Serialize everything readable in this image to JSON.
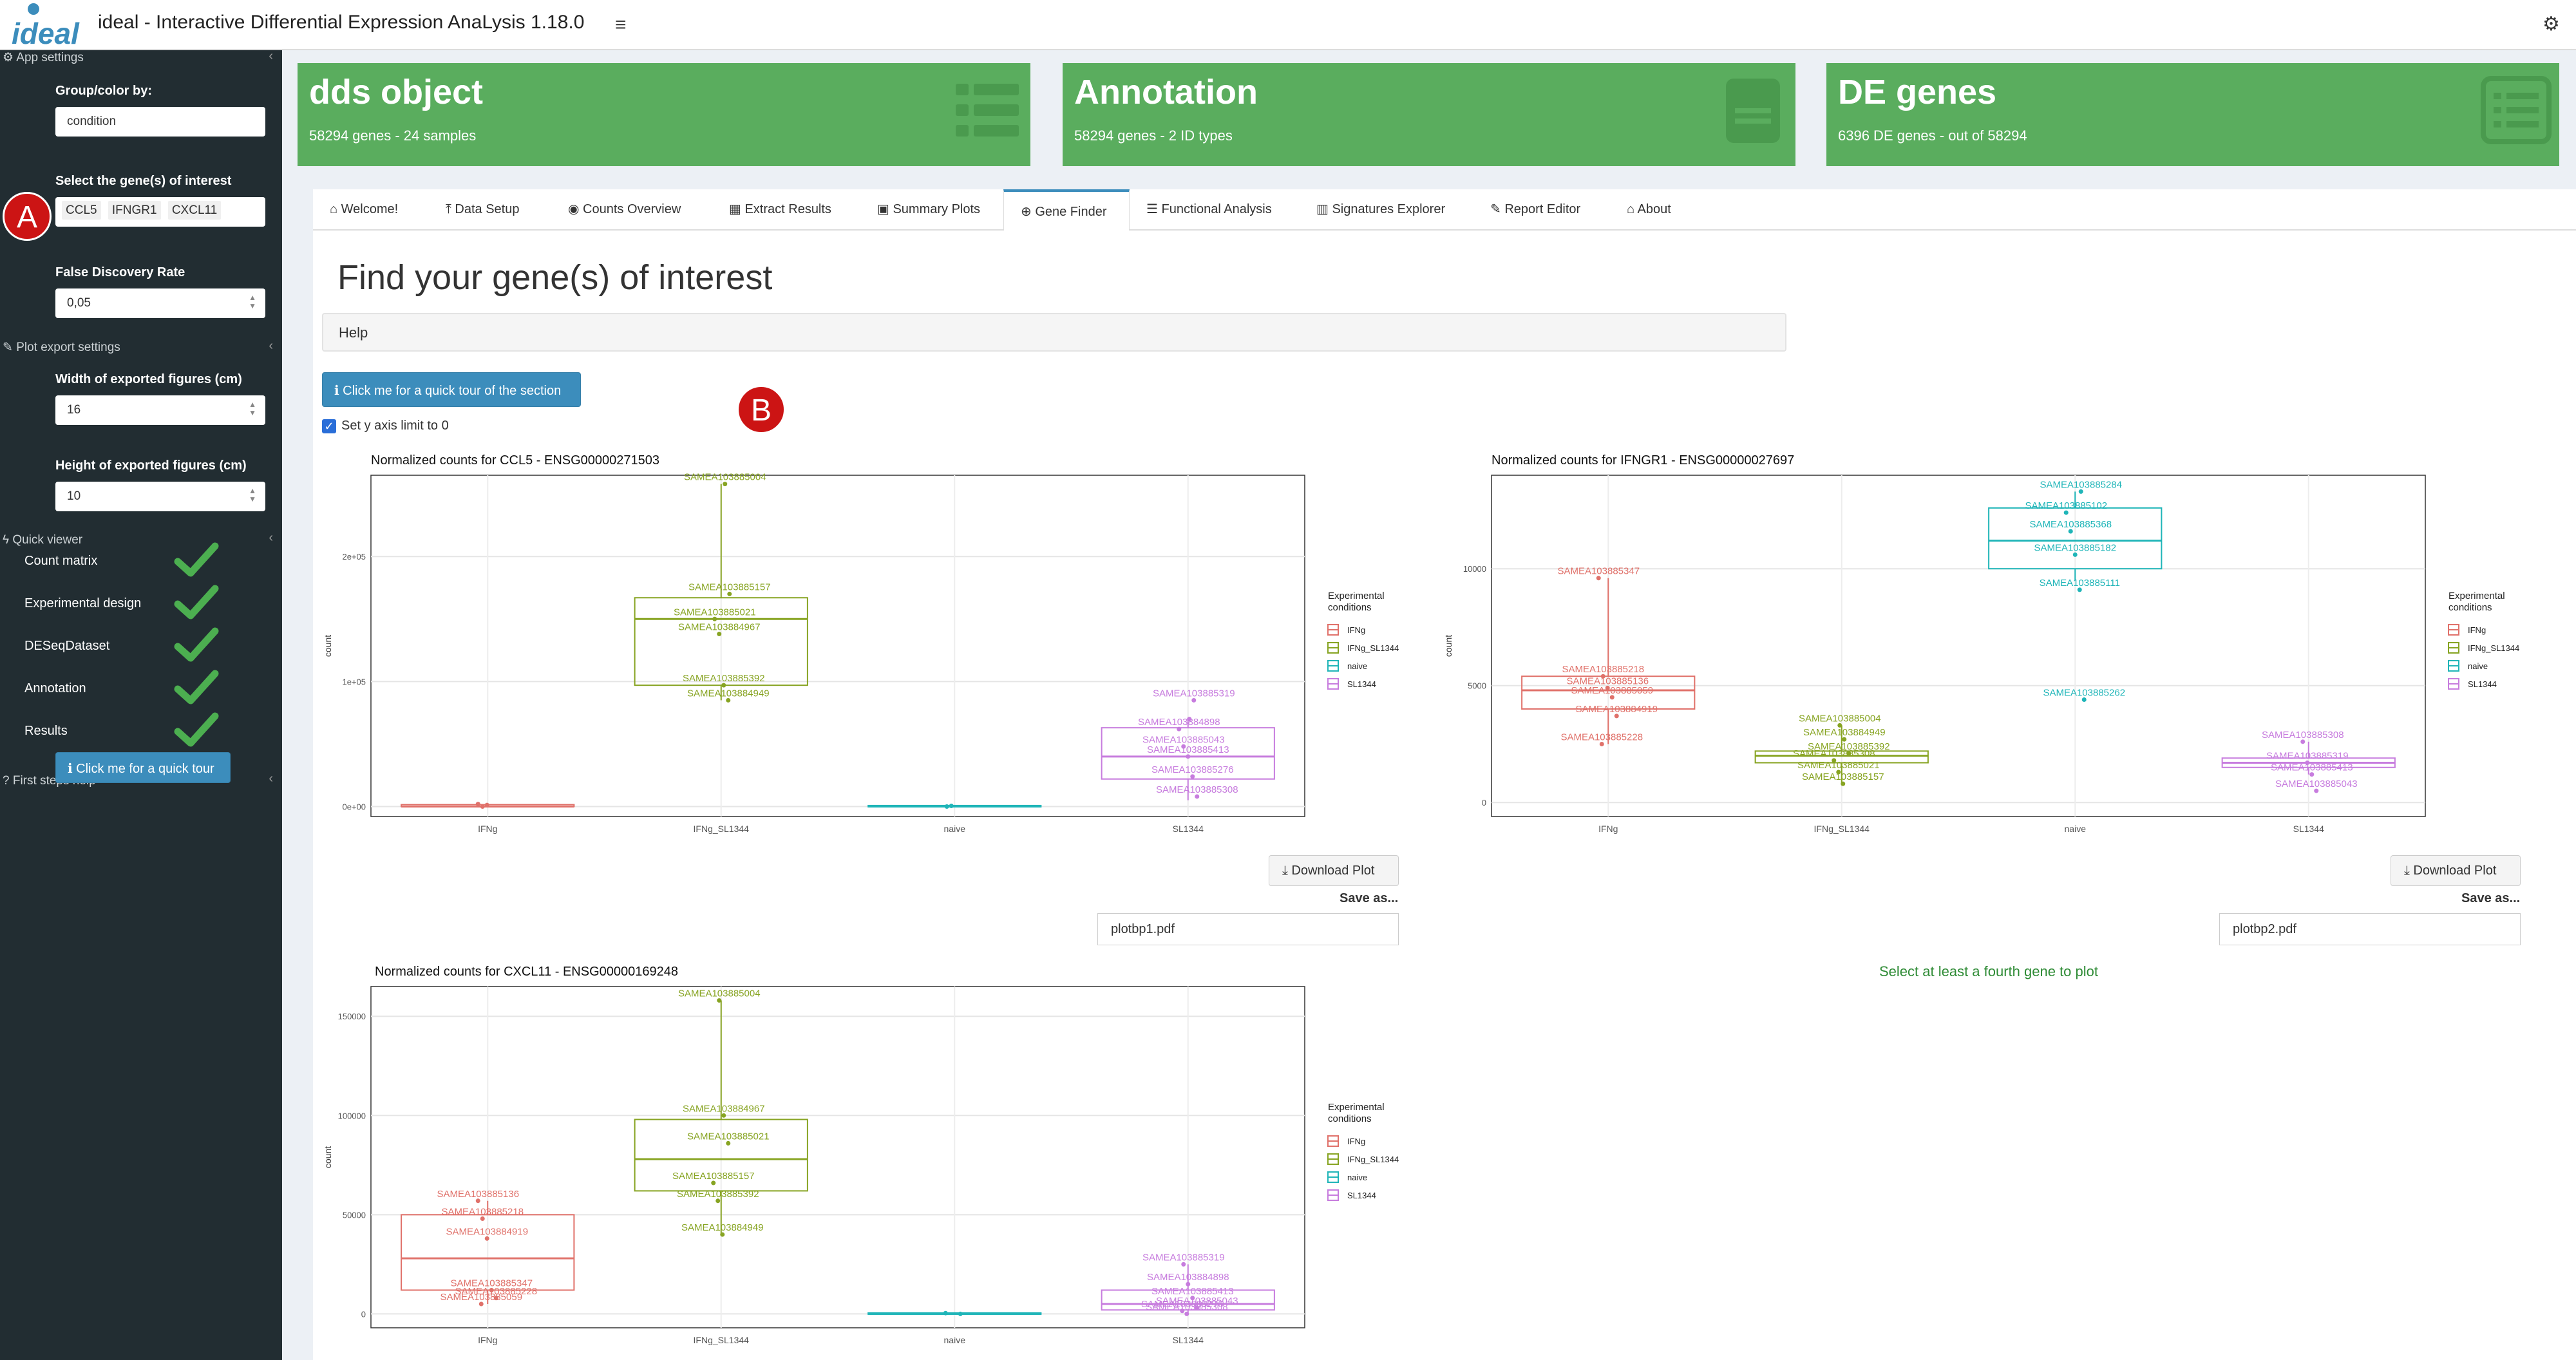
{
  "header": {
    "app_title": "ideal - Interactive Differential Expression AnaLysis 1.18.0",
    "logo_text": "ideal"
  },
  "sidebar": {
    "app_settings": "App settings",
    "group_label": "Group/color by:",
    "group_value": "condition",
    "genes_label": "Select the gene(s) of interest",
    "genes": [
      "CCL5",
      "IFNGR1",
      "CXCL11"
    ],
    "fdr_label": "False Discovery Rate",
    "fdr_value": "0,05",
    "plot_export": "Plot export settings",
    "width_label": "Width of exported figures (cm)",
    "width_value": "16",
    "height_label": "Height of exported figures (cm)",
    "height_value": "10",
    "quick_viewer": "Quick viewer",
    "quick_items": [
      "Count matrix",
      "Experimental design",
      "DESeqDataset",
      "Annotation",
      "Results"
    ],
    "first_steps": "First steps help",
    "tour_button": "Click me for a quick tour"
  },
  "markers": {
    "a": "A",
    "b": "B"
  },
  "value_boxes": [
    {
      "title": "dds object",
      "subtitle": "58294 genes - 24 samples"
    },
    {
      "title": "Annotation",
      "subtitle": "58294 genes - 2 ID types"
    },
    {
      "title": "DE genes",
      "subtitle": "6396 DE genes - out of 58294"
    }
  ],
  "tabs": [
    "Welcome!",
    "Data Setup",
    "Counts Overview",
    "Extract Results",
    "Summary Plots",
    "Gene Finder",
    "Functional Analysis",
    "Signatures Explorer",
    "Report Editor",
    "About"
  ],
  "main": {
    "title": "Find your gene(s) of interest",
    "help": "Help",
    "tour_button": "Click me for a quick tour of the section",
    "ylim_label": "Set y axis limit to 0",
    "download_label": "Download Plot",
    "save_as": "Save as...",
    "file1": "plotbp1.pdf",
    "file2": "plotbp2.pdf",
    "fourth_gene": "Select at least a fourth gene to plot"
  },
  "legend": {
    "title_line1": "Experimental",
    "title_line2": "conditions",
    "items": [
      "IFNg",
      "IFNg_SL1344",
      "naive",
      "SL1344"
    ]
  },
  "colors": {
    "IFNg": "#e0716a",
    "IFNg_SL1344": "#87a422",
    "naive": "#1fb5b8",
    "SL1344": "#c77cde",
    "valuebox": "#5aad5e",
    "sidebar": "#222d32",
    "primary": "#3c8dbc"
  },
  "chart_data": [
    {
      "type": "box",
      "title": "Normalized counts for CCL5 - ENSG00000271503",
      "xlabel": "",
      "ylabel": "count",
      "categories": [
        "IFNg",
        "IFNg_SL1344",
        "naive",
        "SL1344"
      ],
      "yticks": [
        "0e+00",
        "1e+05",
        "2e+05"
      ],
      "ytick_values": [
        0,
        100000,
        200000
      ],
      "ylim": [
        -8000,
        265000
      ],
      "boxes": [
        {
          "q1": 0,
          "median": 0,
          "q3": 1500,
          "lo": 0,
          "hi": 2500
        },
        {
          "q1": 97000,
          "median": 150000,
          "q3": 167000,
          "lo": 85000,
          "hi": 258000
        },
        {
          "q1": 0,
          "median": 0,
          "q3": 800,
          "lo": 0,
          "hi": 1200
        },
        {
          "q1": 22000,
          "median": 40000,
          "q3": 63000,
          "lo": 5000,
          "hi": 70000
        }
      ],
      "points": [
        {
          "group": 0,
          "y": 2000
        },
        {
          "group": 0,
          "y": 0
        },
        {
          "group": 0,
          "y": 1200
        },
        {
          "group": 1,
          "y": 258000,
          "label": "SAMEA103885004"
        },
        {
          "group": 1,
          "y": 170000,
          "label": "SAMEA103885157"
        },
        {
          "group": 1,
          "y": 150000,
          "label": "SAMEA103885021"
        },
        {
          "group": 1,
          "y": 138000,
          "label": "SAMEA103884967"
        },
        {
          "group": 1,
          "y": 97000,
          "label": "SAMEA103885392"
        },
        {
          "group": 1,
          "y": 85000,
          "label": "SAMEA103884949"
        },
        {
          "group": 2,
          "y": 0
        },
        {
          "group": 2,
          "y": 500
        },
        {
          "group": 3,
          "y": 70000
        },
        {
          "group": 3,
          "y": 85000,
          "label": "SAMEA103885319"
        },
        {
          "group": 3,
          "y": 62000,
          "label": "SAMEA103884898"
        },
        {
          "group": 3,
          "y": 48000,
          "label": "SAMEA103885043"
        },
        {
          "group": 3,
          "y": 40000,
          "label": "SAMEA103885413"
        },
        {
          "group": 3,
          "y": 24000,
          "label": "SAMEA103885276"
        },
        {
          "group": 3,
          "y": 8000,
          "label": "SAMEA103885308"
        }
      ]
    },
    {
      "type": "box",
      "title": "Normalized counts for IFNGR1 - ENSG00000027697",
      "xlabel": "",
      "ylabel": "count",
      "categories": [
        "IFNg",
        "IFNg_SL1344",
        "naive",
        "SL1344"
      ],
      "yticks": [
        "0",
        "5000",
        "10000"
      ],
      "ytick_values": [
        0,
        5000,
        10000
      ],
      "ylim": [
        -600,
        14000
      ],
      "boxes": [
        {
          "q1": 4000,
          "median": 4800,
          "q3": 5400,
          "lo": 2500,
          "hi": 9600
        },
        {
          "q1": 1700,
          "median": 2000,
          "q3": 2200,
          "lo": 800,
          "hi": 3300
        },
        {
          "q1": 10000,
          "median": 11200,
          "q3": 12600,
          "lo": 9500,
          "hi": 13300
        },
        {
          "q1": 1500,
          "median": 1700,
          "q3": 1900,
          "lo": 1200,
          "hi": 2600
        }
      ],
      "points": [
        {
          "group": 0,
          "y": 9600,
          "label": "SAMEA103885347"
        },
        {
          "group": 0,
          "y": 5400,
          "label": "SAMEA103885218"
        },
        {
          "group": 0,
          "y": 4900,
          "label": "SAMEA103885136"
        },
        {
          "group": 0,
          "y": 4500,
          "label": "SAMEA103885059"
        },
        {
          "group": 0,
          "y": 3700,
          "label": "SAMEA103884919"
        },
        {
          "group": 0,
          "y": 2500,
          "label": "SAMEA103885228"
        },
        {
          "group": 1,
          "y": 3300,
          "label": "SAMEA103885004"
        },
        {
          "group": 1,
          "y": 2700,
          "label": "SAMEA103884949"
        },
        {
          "group": 1,
          "y": 2100,
          "label": "SAMEA103885392"
        },
        {
          "group": 1,
          "y": 1800,
          "label": "SAMEA103885308"
        },
        {
          "group": 1,
          "y": 1300,
          "label": "SAMEA103885021"
        },
        {
          "group": 1,
          "y": 800,
          "label": "SAMEA103885157"
        },
        {
          "group": 2,
          "y": 13300,
          "label": "SAMEA103885284"
        },
        {
          "group": 2,
          "y": 12400,
          "label": "SAMEA103885102"
        },
        {
          "group": 2,
          "y": 11600,
          "label": "SAMEA103885368"
        },
        {
          "group": 2,
          "y": 10600,
          "label": "SAMEA103885182"
        },
        {
          "group": 2,
          "y": 9100,
          "label": "SAMEA103885111"
        },
        {
          "group": 2,
          "y": 4400,
          "label": "SAMEA103885262"
        },
        {
          "group": 3,
          "y": 2600,
          "label": "SAMEA103885308"
        },
        {
          "group": 3,
          "y": 1700,
          "label": "SAMEA103885319"
        },
        {
          "group": 3,
          "y": 1200,
          "label": "SAMEA103885413"
        },
        {
          "group": 3,
          "y": 500,
          "label": "SAMEA103885043"
        }
      ]
    },
    {
      "type": "box",
      "title": "Normalized counts for CXCL11 - ENSG00000169248",
      "xlabel": "",
      "ylabel": "count",
      "categories": [
        "IFNg",
        "IFNg_SL1344",
        "naive",
        "SL1344"
      ],
      "yticks": [
        "0",
        "50000",
        "100000",
        "150000"
      ],
      "ytick_values": [
        0,
        50000,
        100000,
        150000
      ],
      "ylim": [
        -7000,
        165000
      ],
      "boxes": [
        {
          "q1": 12000,
          "median": 28000,
          "q3": 50000,
          "lo": 5000,
          "hi": 57000
        },
        {
          "q1": 62000,
          "median": 78000,
          "q3": 98000,
          "lo": 40000,
          "hi": 158000
        },
        {
          "q1": 0,
          "median": 0,
          "q3": 500,
          "lo": 0,
          "hi": 800
        },
        {
          "q1": 2000,
          "median": 5000,
          "q3": 12000,
          "lo": 0,
          "hi": 25000
        }
      ],
      "points": [
        {
          "group": 0,
          "y": 57000,
          "label": "SAMEA103885136"
        },
        {
          "group": 0,
          "y": 48000,
          "label": "SAMEA103885218"
        },
        {
          "group": 0,
          "y": 38000,
          "label": "SAMEA103884919"
        },
        {
          "group": 0,
          "y": 12000,
          "label": "SAMEA103885347"
        },
        {
          "group": 0,
          "y": 8000,
          "label": "SAMEA103885228"
        },
        {
          "group": 0,
          "y": 5000,
          "label": "SAMEA103885059"
        },
        {
          "group": 1,
          "y": 158000,
          "label": "SAMEA103885004"
        },
        {
          "group": 1,
          "y": 100000,
          "label": "SAMEA103884967"
        },
        {
          "group": 1,
          "y": 86000,
          "label": "SAMEA103885021"
        },
        {
          "group": 1,
          "y": 66000,
          "label": "SAMEA103885157"
        },
        {
          "group": 1,
          "y": 57000,
          "label": "SAMEA103885392"
        },
        {
          "group": 1,
          "y": 40000,
          "label": "SAMEA103884949"
        },
        {
          "group": 2,
          "y": 0
        },
        {
          "group": 2,
          "y": 400
        },
        {
          "group": 3,
          "y": 25000,
          "label": "SAMEA103885319"
        },
        {
          "group": 3,
          "y": 15000,
          "label": "SAMEA103884898"
        },
        {
          "group": 3,
          "y": 8000,
          "label": "SAMEA103885413"
        },
        {
          "group": 3,
          "y": 3000,
          "label": "SAMEA103885043"
        },
        {
          "group": 3,
          "y": 1500,
          "label": "SAMEA103885276"
        },
        {
          "group": 3,
          "y": 0,
          "label": "SAMEA103885308"
        }
      ]
    }
  ]
}
